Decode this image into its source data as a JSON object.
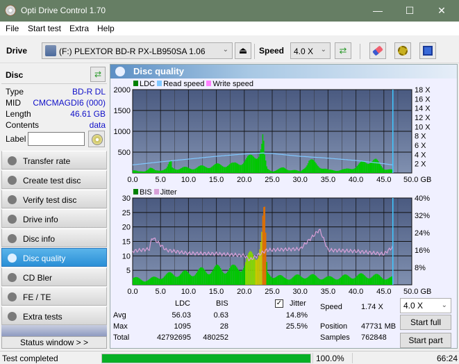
{
  "window": {
    "title": "Opti Drive Control 1.70",
    "minimize": "—",
    "maximize": "☐",
    "close": "✕"
  },
  "menu": [
    "File",
    "Start test",
    "Extra",
    "Help"
  ],
  "toolbar": {
    "drive_label": "Drive",
    "drive_value": "(F:)  PLEXTOR BD-R  PX-LB950SA 1.06",
    "speed_label": "Speed",
    "speed_value": "4.0 X",
    "eject_icon": "⏏",
    "refresh_icon": "⇄",
    "erase_icon": "eraser",
    "settings_icon": "gears",
    "save_icon": "floppy"
  },
  "disc": {
    "header": "Disc",
    "fields": [
      {
        "key": "Type",
        "value": "BD-R DL"
      },
      {
        "key": "MID",
        "value": "CMCMAGDI6 (000)"
      },
      {
        "key": "Length",
        "value": "46.61 GB"
      },
      {
        "key": "Contents",
        "value": "data"
      }
    ],
    "label_key": "Label",
    "label_value": ""
  },
  "nav": [
    {
      "label": "Transfer rate",
      "active": false
    },
    {
      "label": "Create test disc",
      "active": false
    },
    {
      "label": "Verify test disc",
      "active": false
    },
    {
      "label": "Drive info",
      "active": false
    },
    {
      "label": "Disc info",
      "active": false
    },
    {
      "label": "Disc quality",
      "active": true
    },
    {
      "label": "CD Bler",
      "active": false
    },
    {
      "label": "FE / TE",
      "active": false
    },
    {
      "label": "Extra tests",
      "active": false
    }
  ],
  "status_window_label": "Status window > >",
  "panel_title": "Disc quality",
  "colors": {
    "ldc": "#00c800",
    "read_speed": "#80c8ff",
    "write_speed": "#ff80ff",
    "bis": "#00c800",
    "jitter": "#d8a0d8",
    "plot_bg_top": "#4a5a80",
    "plot_bg_bottom": "#8090b0",
    "accent_progress": "#06b025"
  },
  "chart_data": [
    {
      "type": "bar",
      "title": "LDC / Read speed",
      "legend": [
        "LDC",
        "Read speed",
        "Write speed"
      ],
      "legend_position": "top-left",
      "xlabel": "GB",
      "xlim": [
        0,
        50
      ],
      "x_ticks": [
        "0.0",
        "5.0",
        "10.0",
        "15.0",
        "20.0",
        "25.0",
        "30.0",
        "35.0",
        "40.0",
        "45.0",
        "50.0 GB"
      ],
      "ylim_left": [
        0,
        2000
      ],
      "y_ticks_left": [
        "500",
        "1000",
        "1500",
        "2000"
      ],
      "ylim_right": [
        0,
        18
      ],
      "y_ticks_right": [
        "2 X",
        "4 X",
        "6 X",
        "8 X",
        "10 X",
        "12 X",
        "14 X",
        "16 X",
        "18 X"
      ],
      "grid": true,
      "end_marker_gb": 46.61,
      "ldc_series": {
        "name": "LDC",
        "x": [
          0,
          1,
          2,
          3,
          4,
          5,
          6,
          6.8,
          7,
          8,
          9,
          10,
          11,
          12,
          13,
          14,
          15,
          16,
          17,
          18,
          19,
          20,
          21,
          22,
          22.5,
          23,
          23.3,
          23.5,
          24,
          25,
          27,
          30,
          31.5,
          35,
          38,
          40,
          42.5,
          43.5,
          45,
          46.5
        ],
        "values": [
          80,
          40,
          60,
          150,
          70,
          100,
          130,
          350,
          160,
          140,
          150,
          150,
          160,
          180,
          200,
          220,
          230,
          250,
          260,
          250,
          330,
          380,
          450,
          600,
          650,
          800,
          1095,
          500,
          120,
          60,
          150,
          40,
          380,
          80,
          100,
          200,
          420,
          350,
          150,
          80
        ]
      },
      "read_speed_series": {
        "name": "Read speed",
        "x": [
          0,
          5,
          10,
          15,
          20,
          23.4,
          25,
          30,
          35,
          40,
          45,
          46.6
        ],
        "values": [
          1.74,
          2.4,
          3.0,
          3.6,
          4.1,
          4.3,
          4.2,
          3.6,
          3.2,
          2.7,
          2.0,
          1.74
        ]
      }
    },
    {
      "type": "bar",
      "title": "BIS / Jitter",
      "legend": [
        "BIS",
        "Jitter"
      ],
      "legend_position": "top-left",
      "xlabel": "GB",
      "xlim": [
        0,
        50
      ],
      "x_ticks": [
        "0.0",
        "5.0",
        "10.0",
        "15.0",
        "20.0",
        "25.0",
        "30.0",
        "35.0",
        "40.0",
        "45.0",
        "50.0 GB"
      ],
      "ylim_left": [
        0,
        30
      ],
      "y_ticks_left": [
        "5",
        "10",
        "15",
        "20",
        "25",
        "30"
      ],
      "ylim_right": [
        0,
        40
      ],
      "y_ticks_right": [
        "8%",
        "16%",
        "24%",
        "32%",
        "40%"
      ],
      "grid": true,
      "end_marker_gb": 46.61,
      "bis_series": {
        "name": "BIS",
        "x": [
          0,
          2,
          4,
          5.5,
          8,
          10,
          12,
          15,
          18,
          20,
          21,
          22,
          22.5,
          23,
          23.3,
          23.6,
          24,
          27,
          31,
          35,
          40,
          43,
          46
        ],
        "values": [
          3,
          2,
          3,
          4,
          5,
          5,
          6,
          7,
          7,
          9,
          12,
          15,
          17,
          21,
          28,
          27,
          5,
          3,
          4,
          3,
          4,
          4,
          3
        ]
      },
      "jitter_series": {
        "name": "Jitter",
        "x": [
          0,
          3,
          3.5,
          6,
          10,
          15,
          20,
          21,
          23,
          24,
          30,
          33.5,
          35,
          40,
          45,
          46.6
        ],
        "values": [
          15.5,
          16.5,
          22,
          16,
          14.5,
          14.3,
          13.5,
          11.5,
          14.5,
          16,
          16.5,
          25.5,
          16,
          15.5,
          14.2,
          17.5
        ]
      }
    }
  ],
  "stats": {
    "col_ldc": "LDC",
    "col_bis": "BIS",
    "jitter_label": "Jitter",
    "jitter_checked": true,
    "rows": [
      {
        "key": "Avg",
        "ldc": "56.03",
        "bis": "0.63",
        "jitter": "14.8%"
      },
      {
        "key": "Max",
        "ldc": "1095",
        "bis": "28",
        "jitter": "25.5%"
      },
      {
        "key": "Total",
        "ldc": "42792695",
        "bis": "480252",
        "jitter": ""
      }
    ],
    "speed_label": "Speed",
    "speed_value": "1.74 X",
    "position_label": "Position",
    "position_value": "47731 MB",
    "samples_label": "Samples",
    "samples_value": "762848",
    "speed_select": "4.0 X",
    "start_full": "Start full",
    "start_part": "Start part"
  },
  "statusbar": {
    "status_text": "Test completed",
    "progress": 1.0,
    "progress_text": "100.0%",
    "elapsed": "66:24"
  }
}
